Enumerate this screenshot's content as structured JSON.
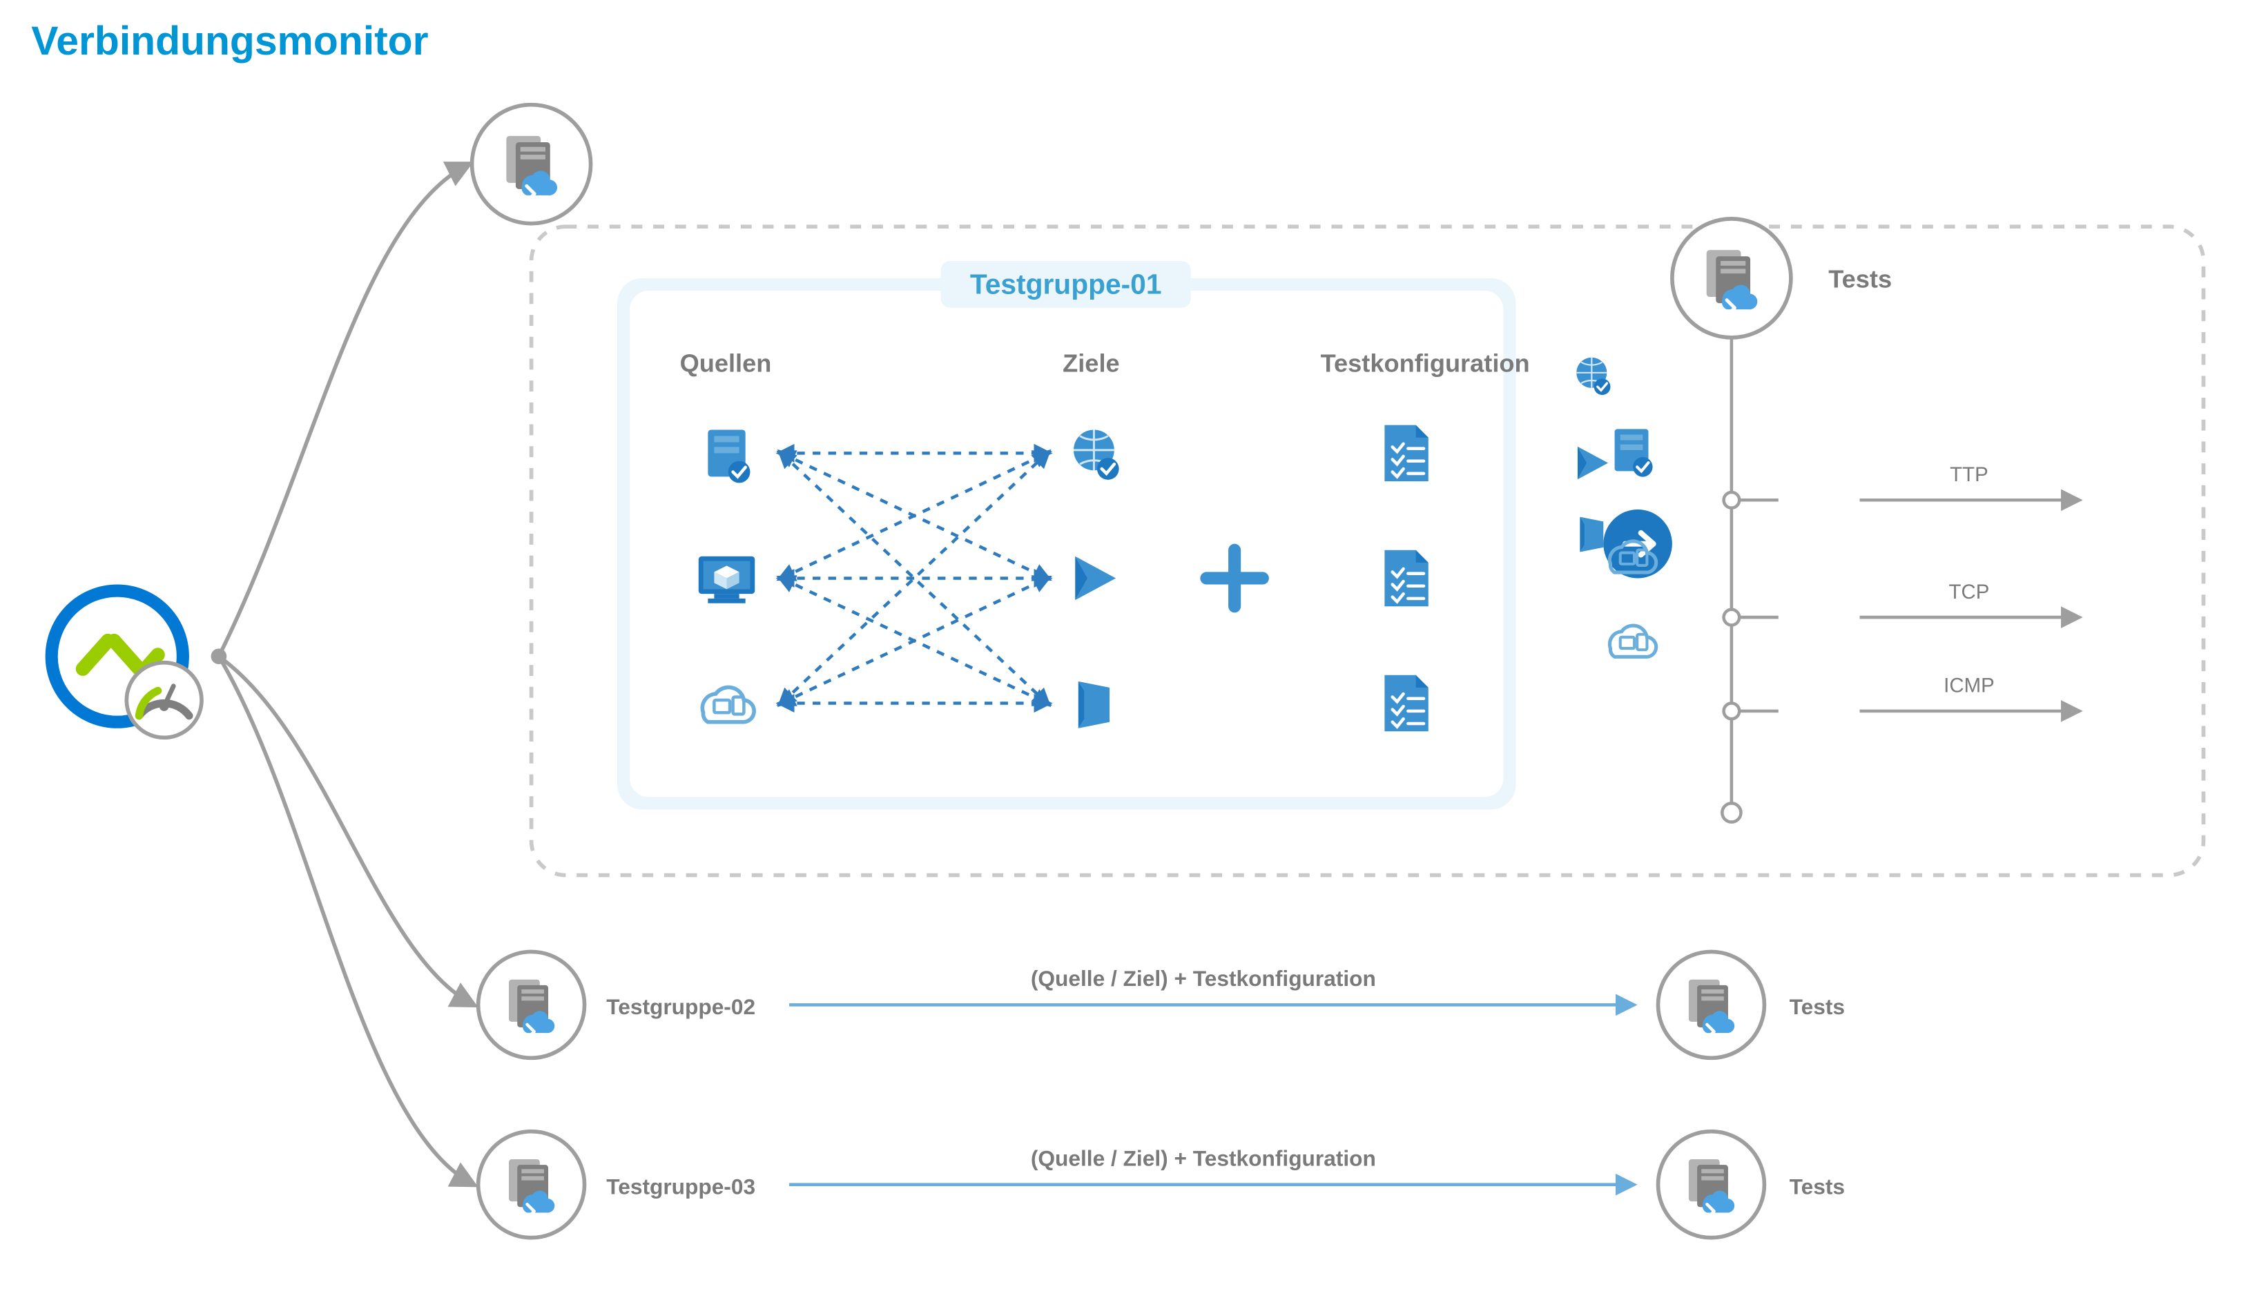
{
  "title": "Verbindungsmonitor",
  "testgroup1": {
    "title": "Testgruppe-01",
    "sources_label": "Quellen",
    "targets_label": "Ziele",
    "config_label": "Testkonfiguration"
  },
  "tests_label": "Tests",
  "protocols": {
    "p1": "TTP",
    "p2": "TCP",
    "p3": "ICMP"
  },
  "row2": {
    "group_label": "Testgruppe-02",
    "formula": "(Quelle / Ziel) + Testkonfiguration",
    "tests_label": "Tests"
  },
  "row3": {
    "group_label": "Testgruppe-03",
    "formula": "(Quelle / Ziel) + Testkonfiguration",
    "tests_label": "Tests"
  },
  "colors": {
    "accent_ring": "#0078d4",
    "green": "#9acd00",
    "gray": "#9e9e9e",
    "lightbox_border": "#a9dcf2",
    "lightbox_fill": "#eaf6fc",
    "dash": "#c9c9c9",
    "node_dark": "#7f7f7f",
    "node_light": "#b3b3b3",
    "cloud": "#4ba3e3",
    "blue1": "#1d78c1",
    "blue2": "#3c91d0",
    "blue3": "#6aaedd",
    "arrow_circle": "#1d78c1",
    "thin_blue": "#6aaedd"
  }
}
